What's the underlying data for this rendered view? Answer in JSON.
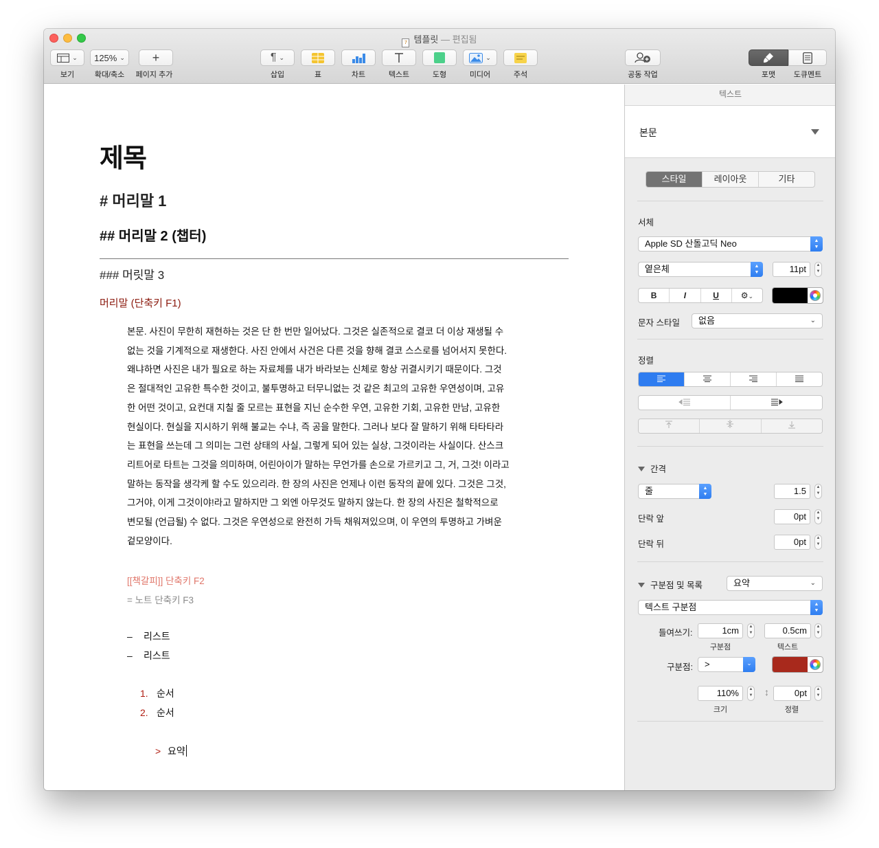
{
  "window": {
    "title": "템플릿",
    "edited": "— 편집됨"
  },
  "toolbar": {
    "view_label": "보기",
    "zoom_value": "125%",
    "zoom_label": "확대/축소",
    "add_page_label": "페이지 추가",
    "insert_label": "삽입",
    "table_label": "표",
    "chart_label": "차트",
    "text_label": "텍스트",
    "shape_label": "도형",
    "media_label": "미디어",
    "comment_label": "주석",
    "collaborate_label": "공동 작업",
    "format_label": "포맷",
    "document_label": "도큐멘트"
  },
  "document": {
    "title": "제목",
    "heading1": "# 머리말 1",
    "heading2": "## 머리말 2 (챕터)",
    "heading3": "### 머릿말 3",
    "heading4": "머리말 (단축키 F1)",
    "body_lines": [
      "본문. 사진이 무한히 재현하는 것은 단 한 번만 일어났다. 그것은 실존적으로 결코 더 이상 재생될 수",
      "없는 것을 기계적으로 재생한다. 사진 안에서 사건은 다른 것을 향해 결코 스스로를 넘어서지 못한다.",
      "왜냐하면 사진은 내가 필요로 하는 자료체를 내가 바라보는 신체로 항상 귀결시키기 때문이다. 그것",
      "은 절대적인 고유한 특수한 것이고, 불투명하고 터무니없는 것 같은 최고의 고유한 우연성이며, 고유",
      "한 어떤 것이고, 요컨대 지칠 줄 모르는 표현을 지닌 순수한 우연, 고유한 기회, 고유한 만남, 고유한",
      "현실이다. 현실을 지시하기 위해 불교는 수냐, 즉 공을 말한다. 그러나 보다 잘 말하기 위해 타타타라",
      "는 표현을 쓰는데 그 의미는 그런 상태의 사실, 그렇게 되어 있는 실상, 그것이라는 사실이다. 산스크",
      "리트어로 타트는 그것을 의미하며, 어린아이가 말하는 무언가를 손으로 가르키고 그, 거, 그것! 이라고",
      "말하는 동작을 생각케 할 수도 있으리라. 한 장의 사진은 언제나 이런 동작의 끝에 있다. 그것은 그것,",
      "그거야, 이게 그것이야!라고 말하지만 그 외엔 아무것도 말하지 않는다. 한 장의 사진은 철학적으로",
      "변모될 (언급될) 수 없다. 그것은 우연성으로 완전히 가득 채워져있으며, 이 우연의 투명하고 가벼운",
      "겉모양이다."
    ],
    "bookmark": "[[책갈피]] 단축키 F2",
    "note": "= 노트 단축키 F3",
    "bullet_mark": "–",
    "bullets": [
      "리스트",
      "리스트"
    ],
    "numbered": [
      {
        "num": "1.",
        "text": "순서"
      },
      {
        "num": "2.",
        "text": "순서"
      }
    ],
    "summary_mark": ">",
    "summary_text": "요약"
  },
  "inspector": {
    "header": "텍스트",
    "paragraph_style": "본문",
    "tabs": [
      "스타일",
      "레이아웃",
      "기타"
    ],
    "font_section": "서체",
    "font_family": "Apple SD 산돌고딕 Neo",
    "font_weight": "옅은체",
    "font_size": "11pt",
    "bold": "B",
    "italic": "I",
    "underline": "U",
    "gear": "⚙",
    "text_color": "#000000",
    "char_style_label": "문자 스타일",
    "char_style_value": "없음",
    "alignment_section": "정렬",
    "spacing_section": "간격",
    "spacing_mode": "줄",
    "spacing_value": "1.5",
    "before_para_label": "단락 앞",
    "before_para_value": "0pt",
    "after_para_label": "단락 뒤",
    "after_para_value": "0pt",
    "bullets_section": "구분점 및 목록",
    "bullets_preset": "요약",
    "bullet_type": "텍스트 구분점",
    "indent_label": "들여쓰기:",
    "indent_bullet_value": "1cm",
    "indent_text_value": "0.5cm",
    "indent_bullet_sublabel": "구분점",
    "indent_text_sublabel": "텍스트",
    "bullet_label": "구분점:",
    "bullet_value": ">",
    "bullet_color": "#a8291c",
    "size_value": "110%",
    "align_value": "0pt",
    "size_sublabel": "크기",
    "align_sublabel": "정렬"
  }
}
